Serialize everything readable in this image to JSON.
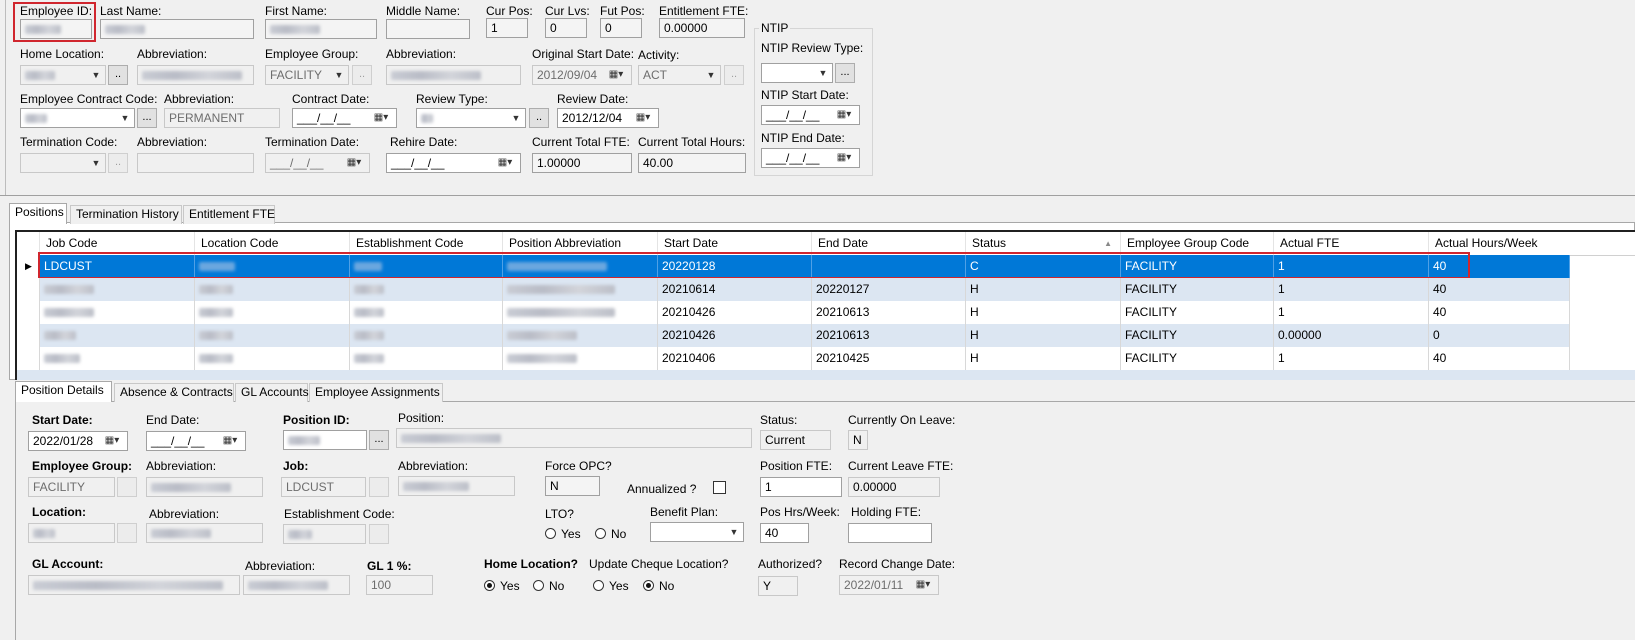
{
  "header": {
    "employee_id_label": "Employee ID:",
    "last_name_label": "Last Name:",
    "first_name_label": "First Name:",
    "middle_name_label": "Middle Name:",
    "cur_pos_label": "Cur Pos:",
    "cur_pos_value": "1",
    "cur_lvs_label": "Cur Lvs:",
    "cur_lvs_value": "0",
    "fut_pos_label": "Fut Pos:",
    "fut_pos_value": "0",
    "entitlement_fte_label": "Entitlement FTE:",
    "entitlement_fte_value": "0.00000",
    "home_location_label": "Home Location:",
    "abbreviation_label": "Abbreviation:",
    "employee_group_label": "Employee Group:",
    "employee_group_value": "FACILITY",
    "original_start_date_label": "Original Start Date:",
    "original_start_date_value": "2012/09/04",
    "activity_label": "Activity:",
    "activity_value": "ACT",
    "employee_contract_code_label": "Employee Contract Code:",
    "contract_abbreviation_value": "PERMANENT",
    "contract_date_label": "Contract Date:",
    "date_placeholder": "___/__/__",
    "review_type_label": "Review Type:",
    "review_date_label": "Review Date:",
    "review_date_value": "2012/12/04",
    "termination_code_label": "Termination Code:",
    "termination_date_label": "Termination Date:",
    "rehire_date_label": "Rehire Date:",
    "current_total_fte_label": "Current Total FTE:",
    "current_total_fte_value": "1.00000",
    "current_total_hours_label": "Current Total Hours:",
    "current_total_hours_value": "40.00",
    "ellipsis": "..",
    "ellipsis3": "..."
  },
  "ntip": {
    "group_title": "NTIP",
    "review_type_label": "NTIP Review Type:",
    "start_date_label": "NTIP Start Date:",
    "end_date_label": "NTIP End Date:"
  },
  "top_tabs": [
    "Positions",
    "Termination History",
    "Entitlement FTE"
  ],
  "grid": {
    "columns": [
      "Job Code",
      "Location Code",
      "Establishment Code",
      "Position Abbreviation",
      "Start Date",
      "End Date",
      "Status",
      "Employee Group Code",
      "Actual FTE",
      "Actual Hours/Week"
    ],
    "rows": [
      {
        "job": "LDCUST",
        "start": "20220128",
        "end": "",
        "status": "C",
        "group": "FACILITY",
        "fte": "1",
        "hours": "40"
      },
      {
        "job": "",
        "start": "20210614",
        "end": "20220127",
        "status": "H",
        "group": "FACILITY",
        "fte": "1",
        "hours": "40"
      },
      {
        "job": "",
        "start": "20210426",
        "end": "20210613",
        "status": "H",
        "group": "FACILITY",
        "fte": "1",
        "hours": "40"
      },
      {
        "job": "",
        "start": "20210426",
        "end": "20210613",
        "status": "H",
        "group": "FACILITY",
        "fte": "0.00000",
        "hours": "0"
      },
      {
        "job": "",
        "start": "20210406",
        "end": "20210425",
        "status": "H",
        "group": "FACILITY",
        "fte": "1",
        "hours": "40"
      }
    ]
  },
  "bottom_tabs": [
    "Position Details",
    "Absence & Contracts",
    "GL Accounts",
    "Employee Assignments"
  ],
  "details": {
    "start_date_label": "Start Date:",
    "start_date_value": "2022/01/28",
    "end_date_label": "End Date:",
    "position_id_label": "Position ID:",
    "position_label": "Position:",
    "status_label": "Status:",
    "status_value": "Current",
    "currently_on_leave_label": "Currently On Leave:",
    "currently_on_leave_value": "N",
    "employee_group_label": "Employee Group:",
    "employee_group_value": "FACILITY",
    "abbreviation_label": "Abbreviation:",
    "job_label": "Job:",
    "job_value": "LDCUST",
    "force_opc_label": "Force OPC?",
    "force_opc_value": "N",
    "annualized_label": "Annualized ?",
    "position_fte_label": "Position FTE:",
    "position_fte_value": "1",
    "current_leave_fte_label": "Current Leave FTE:",
    "current_leave_fte_value": "0.00000",
    "location_label": "Location:",
    "establishment_code_label": "Establishment Code:",
    "lto_label": "LTO?",
    "yes_label": "Yes",
    "no_label": "No",
    "benefit_plan_label": "Benefit Plan:",
    "pos_hrs_week_label": "Pos Hrs/Week:",
    "pos_hrs_week_value": "40",
    "holding_fte_label": "Holding FTE:",
    "gl_account_label": "GL Account:",
    "gl1_label": "GL 1 %:",
    "gl1_value": "100",
    "home_location_label": "Home Location?",
    "update_cheque_location_label": "Update Cheque Location?",
    "authorized_label": "Authorized?",
    "authorized_value": "Y",
    "record_change_date_label": "Record Change Date:",
    "record_change_date_value": "2022/01/11"
  },
  "colors": {
    "selection": "#0078d7",
    "highlight_box": "#d0262e",
    "alt_row": "#dce6f2"
  },
  "icons": [
    "dropdown-arrow-icon",
    "calendar-icon",
    "row-pointer-icon",
    "sort-ascending-icon"
  ]
}
